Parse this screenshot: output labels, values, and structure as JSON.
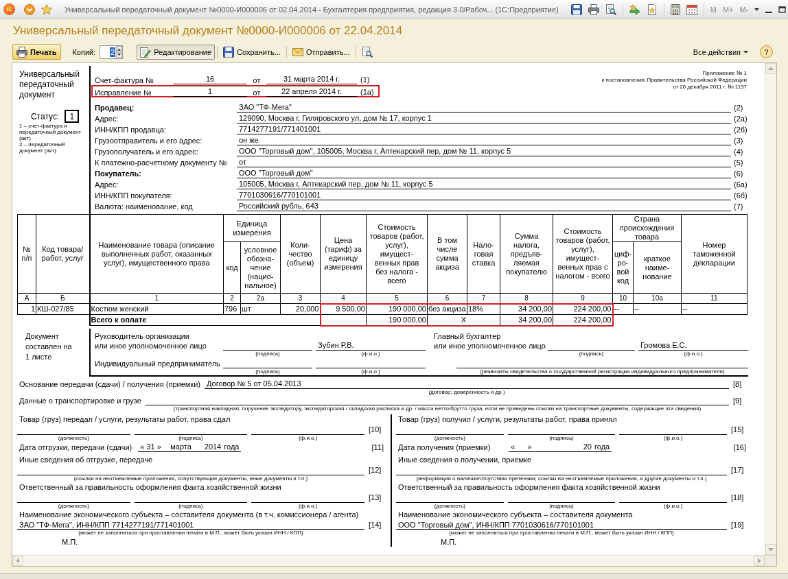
{
  "window": {
    "logo": "1С",
    "title": "Универсальный передаточный документ №0000-И000006 от 02.04.2014 - Бухгалтерия предприятия, редакция 3.0/Рабоч... (1С:Предприятие)",
    "memory_buttons": [
      {
        "label": "M",
        "disabled": true
      },
      {
        "label": "M+",
        "disabled": true
      },
      {
        "label": "M-",
        "disabled": true
      }
    ]
  },
  "heading": "Универсальный передаточный документ №0000-И000006 от 22.04.2014",
  "toolbar": {
    "print_button": {
      "label": "Печать"
    },
    "copies": {
      "label": "Копий:",
      "value": "2",
      "text_selected": true
    },
    "edit_button": {
      "label": "Редактирование",
      "pressed": true
    },
    "save_button": {
      "label": "Сохранить..."
    },
    "send_button": {
      "label": "Отправить..."
    },
    "all_actions": {
      "label": "Все действия"
    },
    "help_button": {
      "label": "?"
    }
  },
  "document": {
    "side": {
      "title": "Универсальный передаточный документ",
      "status_label": "Статус:",
      "status": "1",
      "notes": [
        "1 – счет-фактура и передаточный документ (акт)",
        "2 – передаточный документ (акт)"
      ]
    },
    "invoice_lines": [
      {
        "label": "Счет-фактура №",
        "number": "16",
        "from": "от",
        "date": "31 марта 2014 г.",
        "code": "(1)",
        "highlighted": false
      },
      {
        "label": "Исправление №",
        "number": "1",
        "from": "от",
        "date": "22 апреля 2014 г.",
        "code": "(1а)",
        "highlighted": true
      }
    ],
    "appendix_note": [
      "Приложение № 1",
      "к постановлению Правительства Российской Федерации",
      "от 26 декабря 2011 г. № 1137"
    ],
    "parties": [
      {
        "kind": "party",
        "label": "Продавец:",
        "value": "ЗАО \"ТФ-Мега\"",
        "code": "(2)"
      },
      {
        "kind": "field",
        "label": "Адрес:",
        "value": "129090, Москва г, Гиляровского ул, дом № 17, корпус 1",
        "code": "(2а)"
      },
      {
        "kind": "field",
        "label": "ИНН/КПП продавца:",
        "value": "7714277191/771401001",
        "code": "(2б)"
      },
      {
        "kind": "field",
        "label": "Грузоотправитель и его адрес:",
        "value": "он же",
        "code": "(3)"
      },
      {
        "kind": "field",
        "label": "Грузополучатель и его адрес:",
        "value": "ООО \"Торговый дом\", 105005, Москва г, Аптекарский пер, дом № 11, корпус 5",
        "code": "(4)"
      },
      {
        "kind": "field",
        "label": "К платежно-расчетному документу №",
        "value": "от",
        "code": "(5)"
      },
      {
        "kind": "party",
        "label": "Покупатель:",
        "value": "ООО \"Торговый дом\"",
        "code": "(6)"
      },
      {
        "kind": "field",
        "label": "Адрес:",
        "value": "105005, Москва г, Аптекарский пер, дом № 11, корпус 5",
        "code": "(6а)"
      },
      {
        "kind": "field",
        "label": "ИНН/КПП покупателя:",
        "value": "7701030616/770101001",
        "code": "(6б)"
      },
      {
        "kind": "field",
        "label": "Валюта: наименование, код",
        "value": "Российский рубль, 643",
        "code": "(7)"
      }
    ],
    "table": {
      "columns": [
        {
          "title": "№ п/п",
          "number": "А"
        },
        {
          "title": "Код товара/ работ, услуг",
          "number": "Б"
        },
        {
          "title": "Наименование товара (описание выполненных работ, оказанных услуг), имущественного права",
          "number": "1"
        },
        {
          "title": "Единица измерения",
          "colspan": 2,
          "children": [
            {
              "title": "код",
              "number": "2"
            },
            {
              "title": "условное обозна-чение (нацио-нальное)",
              "number": "2а"
            }
          ]
        },
        {
          "title": "Коли-чество (объем)",
          "number": "3"
        },
        {
          "title": "Цена (тариф) за единицу измерения",
          "number": "4"
        },
        {
          "title": "Стоимость товаров (работ, услуг), имущест-венных прав без налога - всего",
          "number": "5"
        },
        {
          "title": "В том числе сумма акциза",
          "number": "6"
        },
        {
          "title": "Нало-говая ставка",
          "number": "7"
        },
        {
          "title": "Сумма налога, предъяв-ляемая покупателю",
          "number": "8"
        },
        {
          "title": "Стоимость товаров (работ, услуг), имущест-венных прав с налогом - всего",
          "number": "9"
        },
        {
          "title": "Страна происхождения товара",
          "colspan": 2,
          "children": [
            {
              "title": "циф-ро-вой код",
              "number": "10"
            },
            {
              "title": "краткое наиме-нование",
              "number": "10а"
            }
          ]
        },
        {
          "title": "Номер таможенной декларации",
          "number": "11"
        }
      ],
      "rows": [
        {
          "kind": "item",
          "cells": [
            {
              "value": "1",
              "highlighted": false
            },
            {
              "value": "КШ-027/85",
              "highlighted": false
            },
            {
              "value": "Костюм женский",
              "highlighted": false
            },
            {
              "value": "796",
              "highlighted": false
            },
            {
              "value": "шт",
              "highlighted": false
            },
            {
              "value": "20,000",
              "highlighted": false
            },
            {
              "value": "9 500,00",
              "highlighted": true
            },
            {
              "value": "190 000,00",
              "highlighted": true
            },
            {
              "value": "без акциза",
              "highlighted": true
            },
            {
              "value": "18%",
              "highlighted": true
            },
            {
              "value": "34 200,00",
              "highlighted": true
            },
            {
              "value": "224 200,00",
              "highlighted": true
            },
            {
              "value": "--",
              "highlighted": false
            },
            {
              "value": "--",
              "highlighted": false
            },
            {
              "value": "--",
              "highlighted": false
            }
          ]
        },
        {
          "kind": "total",
          "cells": [
            {
              "colspan": 2,
              "highlighted": false
            },
            {
              "value": "Всего к оплате",
              "colspan": 4,
              "highlighted": false
            },
            {
              "highlighted": true
            },
            {
              "value": "190 000,00",
              "highlighted": true
            },
            {
              "value": "X",
              "colspan": 2,
              "highlighted": true
            },
            {
              "value": "34 200,00",
              "highlighted": true
            },
            {
              "value": "224 200,00",
              "highlighted": true
            },
            {
              "colspan": 4,
              "highlighted": false
            }
          ]
        }
      ]
    },
    "signatures": {
      "sheets_note": "Документ составлен на 1 листе",
      "head": {
        "label_lines": [
          "Руководитель организации",
          "или иное уполномоченное лицо"
        ],
        "name": "Зубин Р.В.",
        "captions": [
          "(подпись)",
          "(ф.и.о.)"
        ]
      },
      "accountant": {
        "label_lines": [
          "Главный бухгалтер",
          "или иное уполномоченное лицо"
        ],
        "name": "Громова Е.С.",
        "captions": [
          "(подпись)",
          "(ф.и.о.)"
        ]
      },
      "entrepreneur": {
        "label": "Индивидуальный предприниматель",
        "captions": [
          "(подпись)",
          "(ф.и.о.)",
          "(реквизиты свидетельства о государственной регистрации индивидуального предпринимателя)"
        ]
      }
    },
    "basis": {
      "label": "Основание передачи (сдачи) / получения (приемки)",
      "value": "Договор № 5 от 05.04.2013",
      "code": "[8]",
      "caption": "(договор; доверенность и др.)"
    },
    "transport": {
      "label": "Данные о транспортировке и грузе",
      "code": "[9]",
      "caption": "(транспортная накладная, поручение экспедитору, экспедиторская / складская расписка и др. / масса нетто/брутто груза, если не приведены ссылки на транспортные документы, содержащие эти сведения)"
    },
    "transfer": [
      {
        "title": "Товар (груз) передал / услуги, результаты работ, права сдал",
        "sign_code": "[10]",
        "sign_captions": [
          "(должность)",
          "(подпись)",
          "(ф.и.о.)"
        ],
        "date_label": "Дата отгрузки, передачи (сдачи)",
        "date": {
          "day_part": "« 31 »",
          "month": "марта",
          "year": "2014",
          "suffix": "года"
        },
        "date_code": "[11]",
        "other_label": "Иные сведения об отгрузке, передаче",
        "other_code": "[12]",
        "other_caption": "(ссылки на неотъемлемые приложения, сопутствующие документы, иные документы и т.п.)",
        "responsible_label": "Ответственный за правильность оформления факта хозяйственной жизни",
        "responsible_code": "[13]",
        "responsible_captions": [
          "(должность)",
          "(подпись)",
          "(ф.и.о.)"
        ],
        "entity_label": "Наименование экономического субъекта – составителя документа (в т.ч. комиссионера / агента)",
        "entity_value": "ЗАО \"ТФ-Мега\", ИНН/КПП 7714277191/771401001",
        "entity_code": "[14]",
        "entity_caption": "(может не заполняться при проставлении печати в М.П., может быть указан ИНН / КПП)",
        "stamp": "М.П."
      },
      {
        "title": "Товар (груз) получил / услуги, результаты работ, права принял",
        "sign_code": "[15]",
        "sign_captions": [
          "(должность)",
          "(подпись)",
          "(ф.и.о.)"
        ],
        "date_label": "Дата получения (приемки)",
        "date": {
          "day_part": "«      »",
          "year": "20",
          "suffix": "года"
        },
        "date_code": "[16]",
        "other_label": "Иные сведения о получении, приемке",
        "other_code": "[17]",
        "other_caption": "(информация о наличии/отсутствии претензии; ссылки на неотъемлемые приложения, и другие документы и т.п.)",
        "responsible_label": "Ответственный за правильность оформления факта хозяйственной жизни",
        "responsible_code": "[18]",
        "responsible_captions": [
          "(должность)",
          "(подпись)",
          "(ф.и.о.)"
        ],
        "entity_label": "Наименование экономического субъекта – составителя документа",
        "entity_value": "ООО \"Торговый дом\", ИНН/КПП 7701030616/770101001",
        "entity_code": "[19]",
        "entity_caption": "(может не заполняться при проставлении печати в М.П., может быть указан ИНН / КПП)",
        "stamp": "М.П."
      }
    ]
  }
}
